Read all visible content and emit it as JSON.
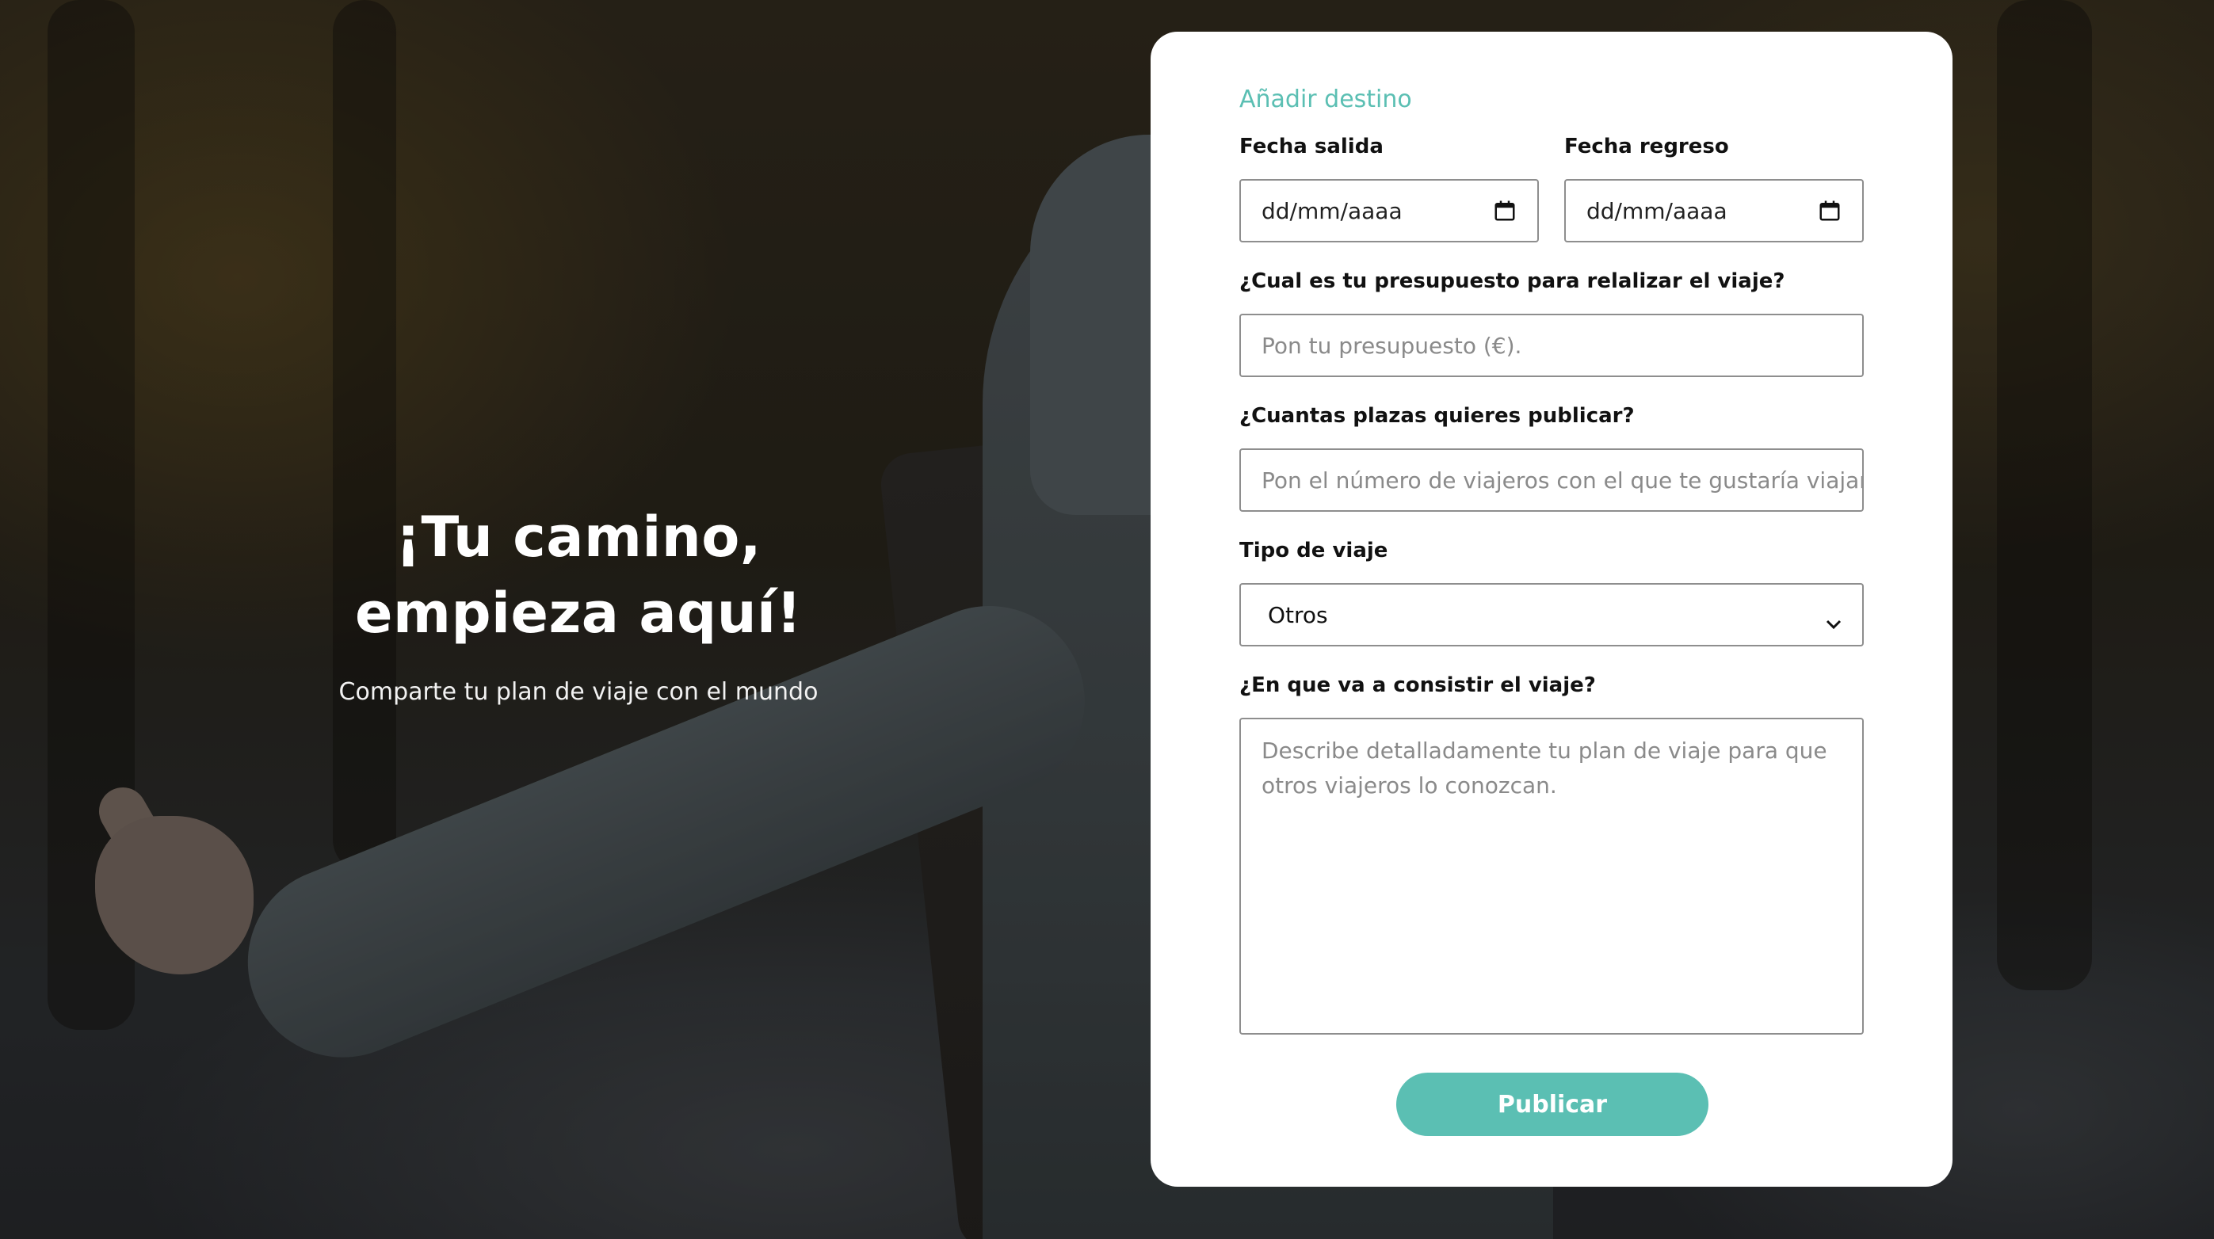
{
  "hero": {
    "title_line1": "¡Tu camino,",
    "title_line2": "empieza aquí!",
    "subtitle": "Comparte tu plan de viaje con el mundo"
  },
  "form": {
    "title": "Añadir destino",
    "departure": {
      "label": "Fecha salida",
      "value": "dd/mm/aaaa",
      "icon": "calendar-icon"
    },
    "return": {
      "label": "Fecha regreso",
      "value": "dd/mm/aaaa",
      "icon": "calendar-icon"
    },
    "budget": {
      "label": "¿Cual es tu presupuesto para relalizar el viaje?",
      "placeholder": "Pon tu presupuesto (€)."
    },
    "seats": {
      "label": "¿Cuantas plazas quieres publicar?",
      "placeholder": "Pon el número de viajeros con el que te gustaría viajar"
    },
    "trip_type": {
      "label": "Tipo de viaje",
      "selected": "Otros",
      "icon": "chevron-down-icon"
    },
    "description": {
      "label": "¿En que va a consistir el viaje?",
      "placeholder": "Describe detalladamente tu plan de viaje para que otros viajeros lo conozcan."
    },
    "submit_label": "Publicar"
  },
  "colors": {
    "accent": "#5bbfb3",
    "card": "#ffffff",
    "border": "#8e8e8e"
  }
}
